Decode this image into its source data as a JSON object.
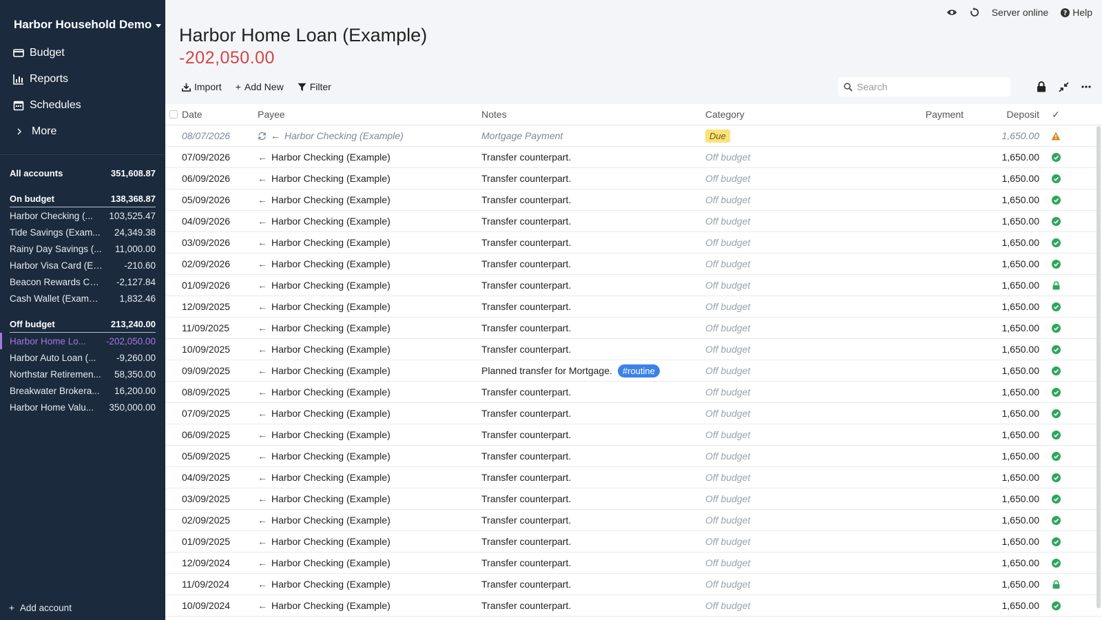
{
  "sidebar": {
    "budget_name": "Harbor Household Demo",
    "nav": [
      {
        "label": "Budget",
        "icon": "wallet-icon"
      },
      {
        "label": "Reports",
        "icon": "chart-icon"
      },
      {
        "label": "Schedules",
        "icon": "calendar-icon"
      },
      {
        "label": "More",
        "icon": "chevron-right-icon"
      }
    ],
    "all_accounts": {
      "label": "All accounts",
      "balance": "351,608.87"
    },
    "on_budget": {
      "label": "On budget",
      "balance": "138,368.87"
    },
    "on_budget_accounts": [
      {
        "name": "Harbor Checking (...",
        "balance": "103,525.47"
      },
      {
        "name": "Tide Savings (Exam...",
        "balance": "24,349.38"
      },
      {
        "name": "Rainy Day Savings (...",
        "balance": "11,000.00"
      },
      {
        "name": "Harbor Visa Card (Ex...",
        "balance": "-210.60"
      },
      {
        "name": "Beacon Rewards Ca...",
        "balance": "-2,127.84"
      },
      {
        "name": "Cash Wallet (Example)",
        "balance": "1,832.46"
      }
    ],
    "off_budget": {
      "label": "Off budget",
      "balance": "213,240.00"
    },
    "off_budget_accounts": [
      {
        "name": "Harbor Home Lo...",
        "balance": "-202,050.00"
      },
      {
        "name": "Harbor Auto Loan (...",
        "balance": "-9,260.00"
      },
      {
        "name": "Northstar Retiremen...",
        "balance": "58,350.00"
      },
      {
        "name": "Breakwater Brokera...",
        "balance": "16,200.00"
      },
      {
        "name": "Harbor Home Valu...",
        "balance": "350,000.00"
      }
    ],
    "add_account": "Add account"
  },
  "topbar": {
    "server_status": "Server online",
    "help": "Help"
  },
  "account": {
    "title": "Harbor Home Loan (Example)",
    "balance": "-202,050.00"
  },
  "toolbar": {
    "import": "Import",
    "add_new": "Add New",
    "filter": "Filter",
    "search_placeholder": "Search"
  },
  "table": {
    "headers": {
      "date": "Date",
      "payee": "Payee",
      "notes": "Notes",
      "category": "Category",
      "payment": "Payment",
      "deposit": "Deposit",
      "cleared": "✓"
    },
    "scheduled": {
      "date": "08/07/2026",
      "payee": "Harbor Checking (Example)",
      "notes": "Mortgage Payment",
      "category": "Due",
      "deposit": "1,650.00"
    },
    "rows": [
      {
        "date": "07/09/2026",
        "payee": "Harbor Checking (Example)",
        "notes": "Transfer counterpart.",
        "tag": "",
        "category": "Off budget",
        "deposit": "1,650.00",
        "status": "cleared"
      },
      {
        "date": "06/09/2026",
        "payee": "Harbor Checking (Example)",
        "notes": "Transfer counterpart.",
        "tag": "",
        "category": "Off budget",
        "deposit": "1,650.00",
        "status": "cleared"
      },
      {
        "date": "05/09/2026",
        "payee": "Harbor Checking (Example)",
        "notes": "Transfer counterpart.",
        "tag": "",
        "category": "Off budget",
        "deposit": "1,650.00",
        "status": "cleared"
      },
      {
        "date": "04/09/2026",
        "payee": "Harbor Checking (Example)",
        "notes": "Transfer counterpart.",
        "tag": "",
        "category": "Off budget",
        "deposit": "1,650.00",
        "status": "cleared"
      },
      {
        "date": "03/09/2026",
        "payee": "Harbor Checking (Example)",
        "notes": "Transfer counterpart.",
        "tag": "",
        "category": "Off budget",
        "deposit": "1,650.00",
        "status": "cleared"
      },
      {
        "date": "02/09/2026",
        "payee": "Harbor Checking (Example)",
        "notes": "Transfer counterpart.",
        "tag": "",
        "category": "Off budget",
        "deposit": "1,650.00",
        "status": "cleared"
      },
      {
        "date": "01/09/2026",
        "payee": "Harbor Checking (Example)",
        "notes": "Transfer counterpart.",
        "tag": "",
        "category": "Off budget",
        "deposit": "1,650.00",
        "status": "locked"
      },
      {
        "date": "12/09/2025",
        "payee": "Harbor Checking (Example)",
        "notes": "Transfer counterpart.",
        "tag": "",
        "category": "Off budget",
        "deposit": "1,650.00",
        "status": "cleared"
      },
      {
        "date": "11/09/2025",
        "payee": "Harbor Checking (Example)",
        "notes": "Transfer counterpart.",
        "tag": "",
        "category": "Off budget",
        "deposit": "1,650.00",
        "status": "cleared"
      },
      {
        "date": "10/09/2025",
        "payee": "Harbor Checking (Example)",
        "notes": "Transfer counterpart.",
        "tag": "",
        "category": "Off budget",
        "deposit": "1,650.00",
        "status": "cleared"
      },
      {
        "date": "09/09/2025",
        "payee": "Harbor Checking (Example)",
        "notes": "Planned transfer for Mortgage.",
        "tag": "#routine",
        "category": "Off budget",
        "deposit": "1,650.00",
        "status": "cleared"
      },
      {
        "date": "08/09/2025",
        "payee": "Harbor Checking (Example)",
        "notes": "Transfer counterpart.",
        "tag": "",
        "category": "Off budget",
        "deposit": "1,650.00",
        "status": "cleared"
      },
      {
        "date": "07/09/2025",
        "payee": "Harbor Checking (Example)",
        "notes": "Transfer counterpart.",
        "tag": "",
        "category": "Off budget",
        "deposit": "1,650.00",
        "status": "cleared"
      },
      {
        "date": "06/09/2025",
        "payee": "Harbor Checking (Example)",
        "notes": "Transfer counterpart.",
        "tag": "",
        "category": "Off budget",
        "deposit": "1,650.00",
        "status": "cleared"
      },
      {
        "date": "05/09/2025",
        "payee": "Harbor Checking (Example)",
        "notes": "Transfer counterpart.",
        "tag": "",
        "category": "Off budget",
        "deposit": "1,650.00",
        "status": "cleared"
      },
      {
        "date": "04/09/2025",
        "payee": "Harbor Checking (Example)",
        "notes": "Transfer counterpart.",
        "tag": "",
        "category": "Off budget",
        "deposit": "1,650.00",
        "status": "cleared"
      },
      {
        "date": "03/09/2025",
        "payee": "Harbor Checking (Example)",
        "notes": "Transfer counterpart.",
        "tag": "",
        "category": "Off budget",
        "deposit": "1,650.00",
        "status": "cleared"
      },
      {
        "date": "02/09/2025",
        "payee": "Harbor Checking (Example)",
        "notes": "Transfer counterpart.",
        "tag": "",
        "category": "Off budget",
        "deposit": "1,650.00",
        "status": "cleared"
      },
      {
        "date": "01/09/2025",
        "payee": "Harbor Checking (Example)",
        "notes": "Transfer counterpart.",
        "tag": "",
        "category": "Off budget",
        "deposit": "1,650.00",
        "status": "cleared"
      },
      {
        "date": "12/09/2024",
        "payee": "Harbor Checking (Example)",
        "notes": "Transfer counterpart.",
        "tag": "",
        "category": "Off budget",
        "deposit": "1,650.00",
        "status": "cleared"
      },
      {
        "date": "11/09/2024",
        "payee": "Harbor Checking (Example)",
        "notes": "Transfer counterpart.",
        "tag": "",
        "category": "Off budget",
        "deposit": "1,650.00",
        "status": "locked"
      },
      {
        "date": "10/09/2024",
        "payee": "Harbor Checking (Example)",
        "notes": "Transfer counterpart.",
        "tag": "",
        "category": "Off budget",
        "deposit": "1,650.00",
        "status": "cleared"
      }
    ]
  },
  "colors": {
    "sidebar_bg": "#1b2a3d",
    "negative": "#d24545",
    "active_account": "#a479e0",
    "cleared_green": "#2fa65a",
    "warning": "#d98a1f",
    "tag_blue": "#3b82e8",
    "due_yellow": "#fbe27a"
  }
}
